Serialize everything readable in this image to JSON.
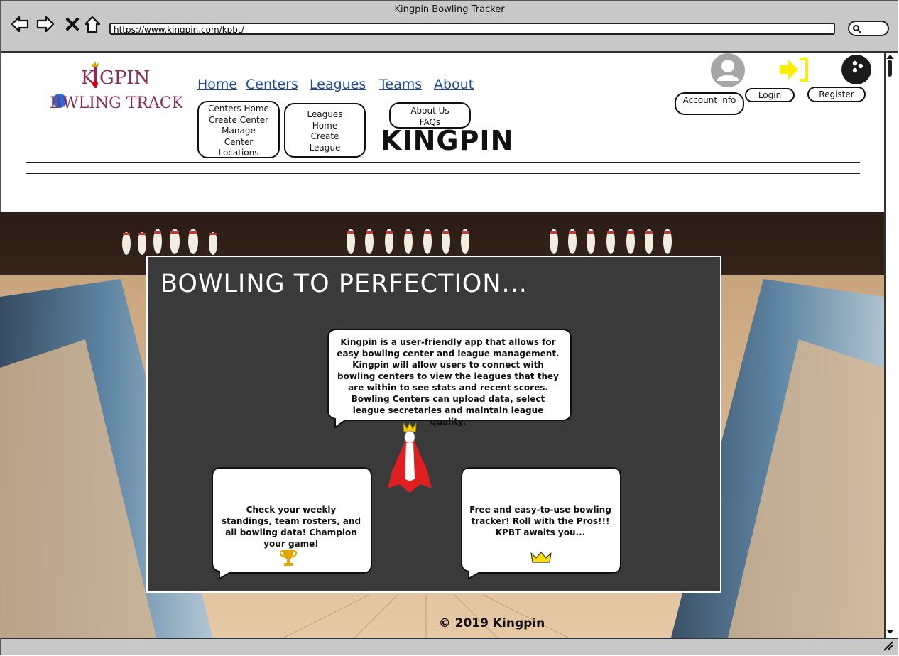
{
  "window": {
    "title": "Kingpin Bowling Tracker",
    "url": "https://www.kingpin.com/kpbt/"
  },
  "brand": {
    "logo_line1": "KINGPIN",
    "logo_line2": "BOWLING TRACKER",
    "banner": "KINGPIN"
  },
  "nav": {
    "items": [
      "Home",
      "Centers",
      "Leagues",
      "Teams",
      "About"
    ],
    "centers_menu": [
      "Centers Home",
      "Create Center",
      "Manage Center",
      "Locations"
    ],
    "leagues_menu": [
      "Leagues Home",
      "Create League"
    ],
    "about_menu": [
      "About Us",
      "FAQs"
    ]
  },
  "user": {
    "account_label": "Account info",
    "login_label": "Login",
    "register_label": "Register"
  },
  "hero": {
    "title": "BOWLING TO PERFECTION...",
    "intro": "Kingpin is a user-friendly app that allows for easy bowling center and league management. Kingpin will allow users to connect with bowling centers to view the leagues that they are within to see stats and recent scores. Bowling Centers can upload data, select league secretaries and maintain league quality.",
    "card_left": "Check your weekly standings, team rosters, and all bowling data! Champion your game!",
    "card_right": "Free and easy-to-use bowling tracker! Roll with the Pros!!! KPBT awaits you..."
  },
  "footer": {
    "copyright": "© 2019 Kingpin"
  },
  "colors": {
    "link": "#1a4d9c",
    "panel": "#3a3a3a",
    "login_icon": "#ffee00",
    "trophy": "#e0a800",
    "crown": "#ffe000"
  }
}
